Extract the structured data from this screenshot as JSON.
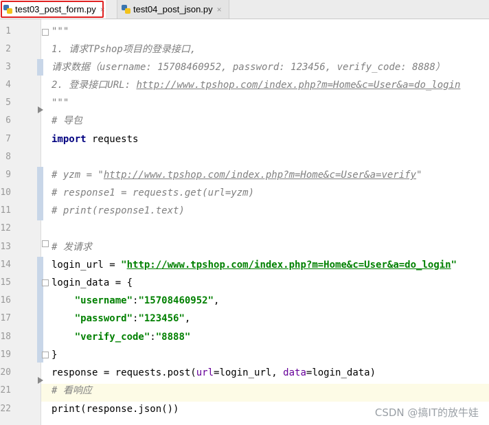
{
  "tabs": [
    {
      "label": "test03_post_form.py",
      "active": true
    },
    {
      "label": "test04_post_json.py",
      "active": false
    }
  ],
  "close_glyph": "×",
  "line_numbers": [
    "1",
    "2",
    "3",
    "4",
    "5",
    "6",
    "7",
    "8",
    "9",
    "10",
    "11",
    "12",
    "13",
    "14",
    "15",
    "16",
    "17",
    "18",
    "19",
    "20",
    "21",
    "22"
  ],
  "code": {
    "l1": "\"\"\"",
    "l2": "1. 请求TPshop项目的登录接口,",
    "l3": "请求数据（username: 15708460952, password: 123456, verify_code: 8888）",
    "l4_pre": "2. 登录接口URL: ",
    "l4_url": "http://www.tpshop.com/index.php?m=Home&c=User&a=do_login",
    "l5": "\"\"\"",
    "l6": "# 导包",
    "l7_kw": "import",
    "l7_rest": " requests",
    "l9_a": "# yzm = \"",
    "l9_url": "http://www.tpshop.com/index.php?m=Home&c=User&a=verify",
    "l9_b": "\"",
    "l10": "# response1 = requests.get(url=yzm)",
    "l11": "# print(response1.text)",
    "l13": "# 发请求",
    "l14_a": "login_url = ",
    "l14_q1": "\"",
    "l14_url": "http://www.tpshop.com/index.php?m=Home&c=User&a=do_login",
    "l14_q2": "\"",
    "l15": "login_data = {",
    "l16_k": "\"username\"",
    "l16_colon": ":",
    "l16_v": "\"15708460952\"",
    "l16_end": ",",
    "l17_k": "\"password\"",
    "l17_colon": ":",
    "l17_v": "\"123456\"",
    "l17_end": ",",
    "l18_k": "\"verify_code\"",
    "l18_colon": ":",
    "l18_v": "\"8888\"",
    "l19": "}",
    "l20_a": "response = requests.post(",
    "l20_p1": "url",
    "l20_b": "=login_url, ",
    "l20_p2": "data",
    "l20_c": "=login_data)",
    "l21": "# 看响应",
    "l22": "print(response.json())"
  },
  "watermark": "CSDN @搞IT的放牛娃",
  "colors": {
    "highlight_tab": "#e02020",
    "string": "#008000",
    "keyword": "#000080",
    "comment": "#808080"
  }
}
